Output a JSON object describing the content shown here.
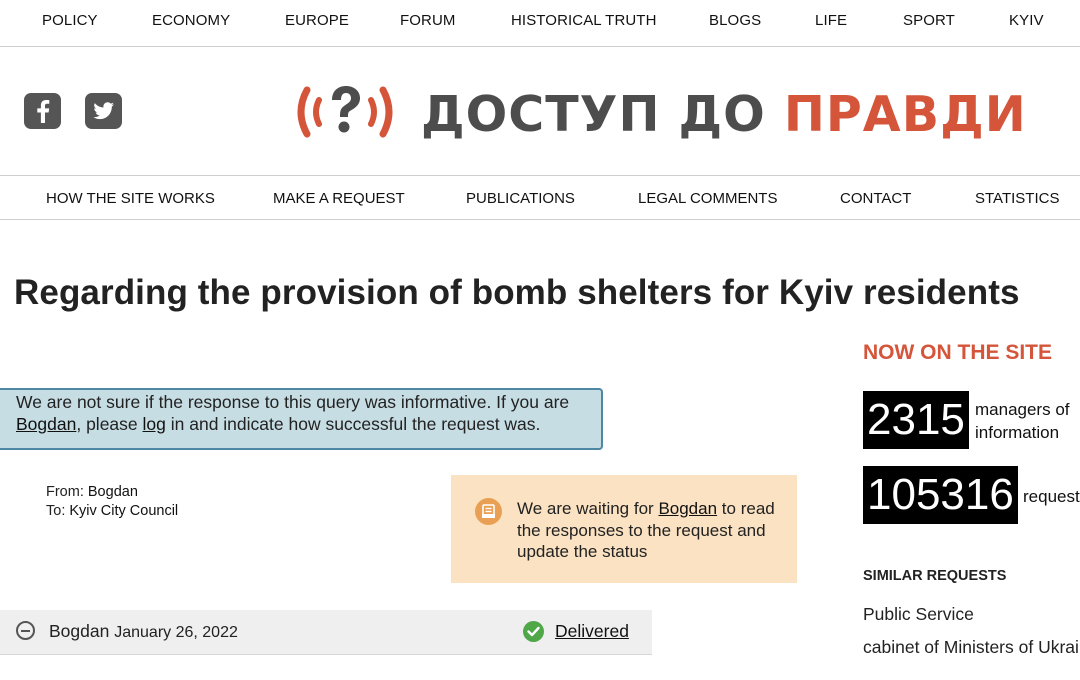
{
  "top_nav": [
    "POLICY",
    "ECONOMY",
    "EUROPE",
    "FORUM",
    "HISTORICAL TRUTH",
    "BLOGS",
    "LIFE",
    "SPORT",
    "KYIV"
  ],
  "logo": {
    "word1": "ДОСТУП ДО",
    "word2": "ПРАВДИ",
    "color_dark": "#4d4d4d",
    "color_accent": "#d4553a"
  },
  "social": [
    "facebook-icon",
    "twitter-icon"
  ],
  "main_nav": [
    "HOW THE SITE WORKS",
    "MAKE A REQUEST",
    "PUBLICATIONS",
    "LEGAL COMMENTS",
    "CONTACT",
    "STATISTICS"
  ],
  "page_title": "Regarding the provision of bomb shelters for Kyiv residents",
  "notice": {
    "text1": "We are not sure if the response to this query was informative. If you are",
    "user_link": "Bogdan",
    "text2": ", please",
    "log_link": "log",
    "text3": "in and indicate how successful the request was."
  },
  "request": {
    "from_label": "From:",
    "from": "Bogdan",
    "to_label": "To:",
    "to": "Kyiv City Council"
  },
  "status_box": {
    "text1": "We are waiting for",
    "user_link": "Bogdan",
    "text2": "to read the responses to the request and update the status"
  },
  "message": {
    "author": "Bogdan",
    "date": "January 26, 2022",
    "status": "Delivered"
  },
  "sidebar": {
    "title": "NOW ON THE SITE",
    "stats": [
      {
        "value": "2315",
        "label_line1": "managers of",
        "label_line2": "information"
      },
      {
        "value": "105316",
        "label_line1": "requests",
        "label_line2": ""
      }
    ],
    "similar_title": "SIMILAR REQUESTS",
    "similar": [
      "Public Service",
      "cabinet of Ministers of Ukraine"
    ]
  }
}
